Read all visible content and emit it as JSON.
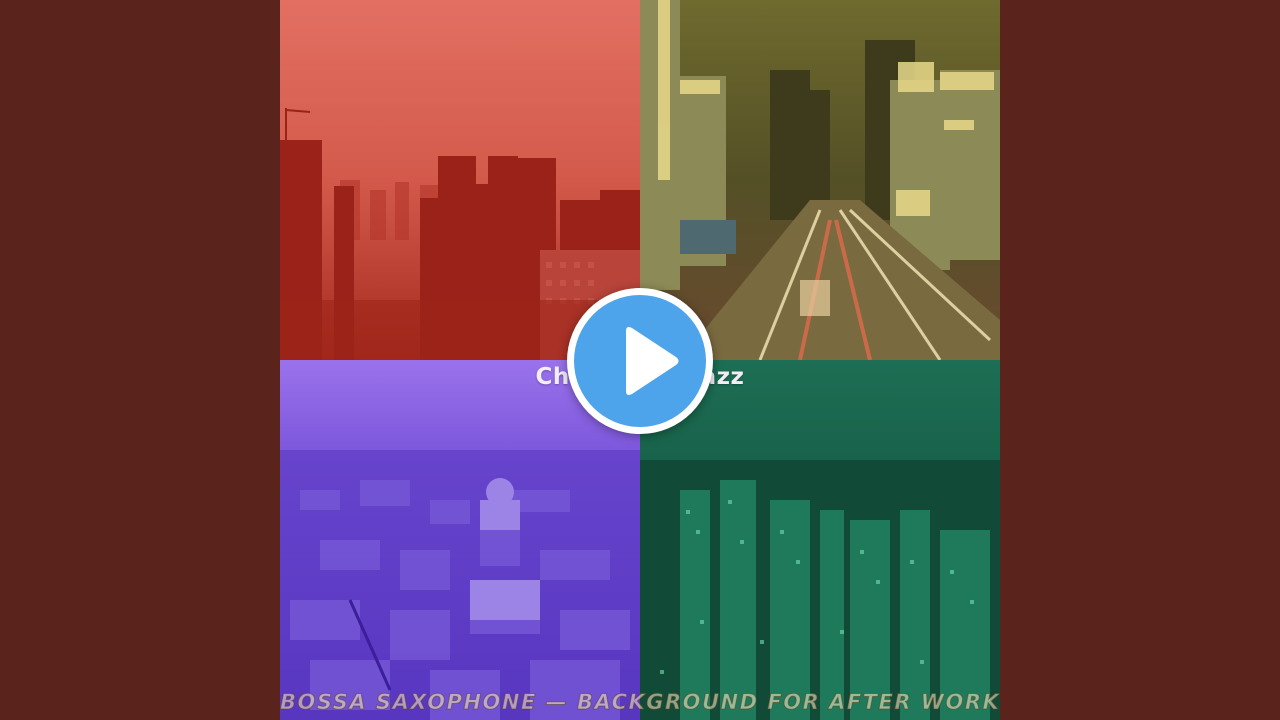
{
  "video": {
    "artist_label": "Chet Baker Jazz",
    "title_text": "BOSSA SAXOPHONE — BACKGROUND FOR AFTER WORK DRINKS",
    "play_icon": "play-icon"
  },
  "colors": {
    "background": "#5a241d",
    "quad_top_left": "#c8483e",
    "quad_top_right": "#8a8a3a",
    "quad_bottom_left": "#7a4ad8",
    "quad_bottom_right": "#1c6a52",
    "play_button_fill": "#4ea4ea",
    "play_button_ring": "#ffffff"
  }
}
